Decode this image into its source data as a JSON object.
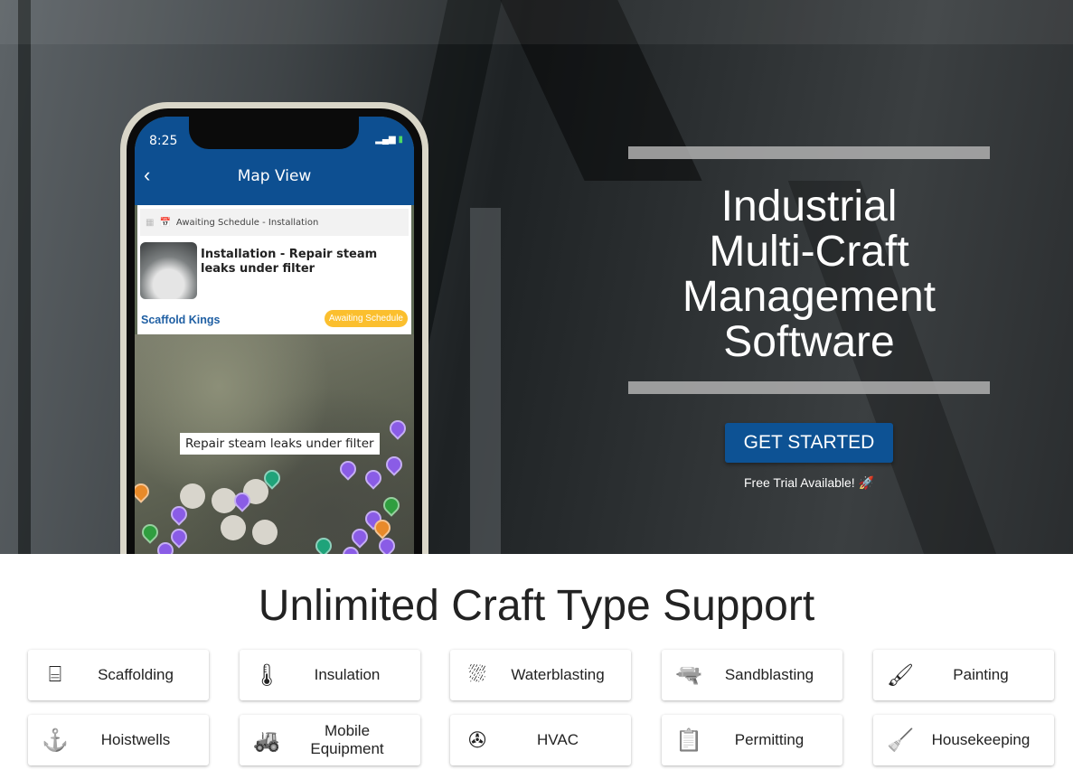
{
  "hero": {
    "title": "Industrial Multi-Craft Management Software",
    "cta_label": "GET STARTED",
    "trial_text": "Free Trial Available! 🚀",
    "accent_color": "#0d5294"
  },
  "phone": {
    "time": "8:25",
    "nav_title": "Map View",
    "card_status": "Awaiting Schedule - Installation",
    "job_title": "Installation - Repair steam leaks under filter",
    "company": "Scaffold Kings",
    "badge": "Awaiting Schedule",
    "map_tooltip": "Repair steam leaks under filter"
  },
  "crafts_section": {
    "heading": "Unlimited Craft Type Support",
    "items": [
      {
        "label": "Scaffolding",
        "icon": "scaffold-icon"
      },
      {
        "label": "Insulation",
        "icon": "thermometer-fire-icon"
      },
      {
        "label": "Waterblasting",
        "icon": "spray-icon"
      },
      {
        "label": "Sandblasting",
        "icon": "spray-gun-icon"
      },
      {
        "label": "Painting",
        "icon": "paint-brush-icon"
      },
      {
        "label": "Hoistwells",
        "icon": "hook-icon"
      },
      {
        "label": "Mobile Equipment",
        "icon": "loader-icon"
      },
      {
        "label": "HVAC",
        "icon": "fan-icon"
      },
      {
        "label": "Permitting",
        "icon": "clipboard-icon"
      },
      {
        "label": "Housekeeping",
        "icon": "broom-icon"
      }
    ]
  }
}
